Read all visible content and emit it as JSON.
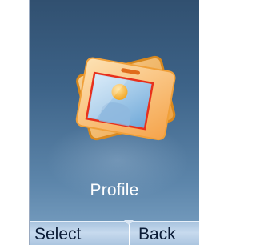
{
  "menu": {
    "current_item": "Profile",
    "icon": "profile-card-icon"
  },
  "softkeys": {
    "left": "Select",
    "right": "Back"
  },
  "colors": {
    "background_top": "#315070",
    "background_bottom": "#7da3c4",
    "card_orange": "#f39a1e",
    "card_light": "#fbd9a0",
    "photo_frame": "#e8301c",
    "softkey_bar": "#c7daee"
  }
}
